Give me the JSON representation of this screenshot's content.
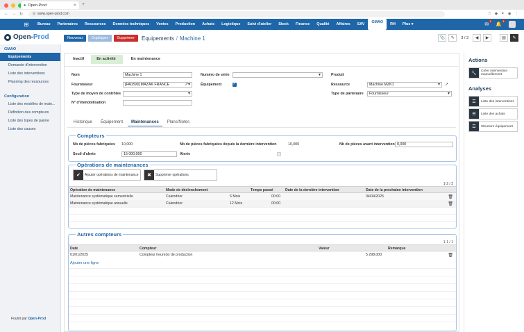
{
  "browser": {
    "tab_title": "Open-Prod",
    "url": "www.open-prod.com",
    "new_tab": "+"
  },
  "topnav": {
    "items": [
      "Bureau",
      "Partenaires",
      "Ressources",
      "Données techniques",
      "Ventes",
      "Production",
      "Achats",
      "Logistique",
      "Suivi d'atelier",
      "Stock",
      "Finance",
      "Qualité",
      "Affaires",
      "SAV",
      "GMAO",
      "RH",
      "Plus ▾"
    ],
    "active_index": 14,
    "msg_badge": "1",
    "notif_badge": "1"
  },
  "logo": {
    "part1": "Open-",
    "part2": "Prod"
  },
  "actions": {
    "new": "Nouveau",
    "duplicate": "Dupliquer",
    "delete": "Supprimer"
  },
  "breadcrumb": {
    "parent": "Equipements",
    "sep": "/",
    "current": "Machine 1"
  },
  "pager": "3 / 3",
  "sidebar": {
    "section1": "GMAO",
    "items1": [
      "Equipements",
      "Demande d'intervention",
      "Liste des interventions",
      "Planning des ressources"
    ],
    "section2": "Configuration",
    "items2": [
      "Liste des modèles de main...",
      "Définition des compteurs",
      "Liste des types de panne",
      "Liste des causes"
    ],
    "footer_prefix": "Fourni par",
    "footer_brand": "Open-Prod"
  },
  "status": [
    "Inactif",
    "En activité",
    "En maintenance"
  ],
  "form": {
    "nom_label": "Nom",
    "nom_value": "Machine 1",
    "fournisseur_label": "Fournisseur",
    "fournisseur_value": "[FA0399] MAZAK FRANCE",
    "type_moyen_label": "Type de moyen de contrôles",
    "type_moyen_value": "",
    "immob_label": "N° d'immobilisation",
    "immob_value": "",
    "serie_label": "Numéro de série",
    "serie_value": "",
    "equipement_label": "Équipement",
    "produit_label": "Produit",
    "ressource_label": "Ressource",
    "ressource_value": "Machine MZK1",
    "type_partenaire_label": "Type de partenaire",
    "type_partenaire_value": "Fournisseur"
  },
  "tabs": [
    "Historique",
    "Équipement",
    "Maintenances",
    "Plans/Notes"
  ],
  "tabs_active_index": 2,
  "compteurs": {
    "title": "Compteurs",
    "pieces_label": "Nb de pièces fabriquées",
    "pieces_value": "10,000",
    "pieces_derniere_label": "Nb de pièces fabriquées depuis la dernière intervention",
    "pieces_derniere_value": "10,000",
    "pieces_avant_label": "Nb de pièces avant intervention",
    "pieces_avant_value": "0,000",
    "seuil_label": "Seuil d'alerte",
    "seuil_value": "15 000,000",
    "alerte_label": "Alerte"
  },
  "operations": {
    "title": "Opérations de maintenances",
    "add_btn": "Ajouter opérations de maintenance",
    "del_btn": "Supprimer opérations",
    "count": "1-2 / 2",
    "headers": [
      "Opération de maintenance",
      "Mode de déclenchement",
      "Temps passé",
      "Date de la dernière intervention",
      "Date de la prochaine intervention"
    ],
    "rows": [
      [
        "Maintenance systématique semestrielle",
        "Calendrier",
        "6 Mois",
        "00:00",
        "",
        "04/04/2025"
      ],
      [
        "Maintenance systématique annuelle",
        "Calendrier",
        "12 Mois",
        "00:00",
        "",
        ""
      ]
    ]
  },
  "autres": {
    "title": "Autres compteurs",
    "count": "1-1 / 1",
    "headers": [
      "Date",
      "Compteur",
      "Valeur",
      "Remarque"
    ],
    "rows": [
      [
        "01/01/2025",
        "Compteur heure(s) de production",
        "5 298,000",
        ""
      ]
    ],
    "add_line": "Ajouter une ligne"
  },
  "right": {
    "actions_title": "Actions",
    "action_btn": "Créer intervention manuellement",
    "analyses_title": "Analyses",
    "analyses": [
      "Liste des interventions",
      "Liste des achats",
      "Structure équipement"
    ]
  }
}
